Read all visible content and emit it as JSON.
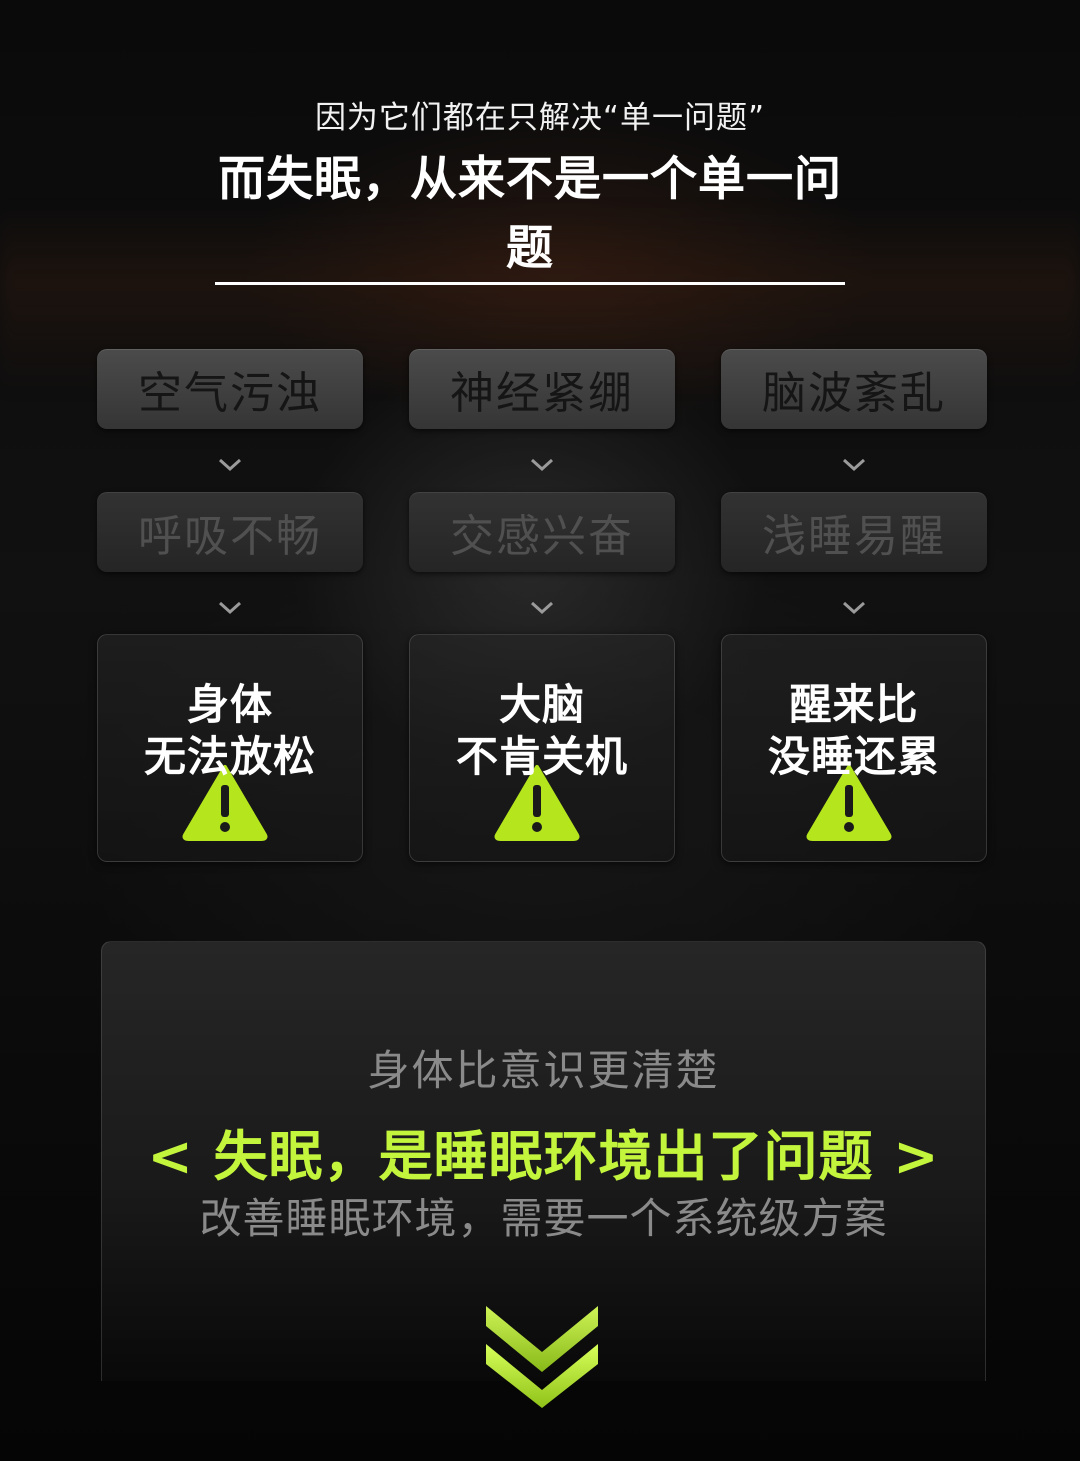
{
  "header": {
    "subtitle": "因为它们都在只解决“单一问题”",
    "title": "而失眠，从来不是一个单一问题"
  },
  "columns": [
    {
      "cause": "空气污浊",
      "effect": "呼吸不畅",
      "result_line1": "身体",
      "result_line2": "无法放松"
    },
    {
      "cause": "神经紧绷",
      "effect": "交感兴奋",
      "result_line1": "大脑",
      "result_line2": "不肯关机"
    },
    {
      "cause": "脑波紊乱",
      "effect": "浅睡易醒",
      "result_line1": "醒来比",
      "result_line2": "没睡还累"
    }
  ],
  "conclusion": {
    "line1": "身体比意识更清楚",
    "line2": "< 失眠，是睡眠环境出了问题 >",
    "line3": "改善睡眠环境，需要一个系统级方案"
  },
  "colors": {
    "accent": "#c3f53c",
    "warning": "#b5e61d"
  },
  "icons": {
    "chevron": "chevron-down-icon",
    "warning": "warning-triangle-icon",
    "scroll": "double-chevron-down-icon"
  }
}
